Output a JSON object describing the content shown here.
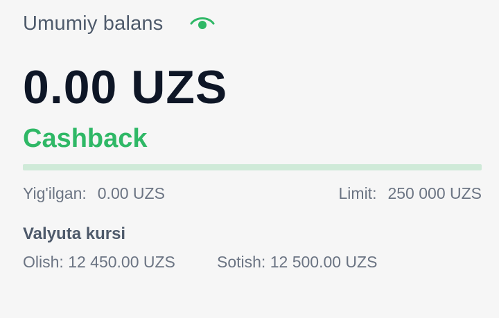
{
  "balance": {
    "label": "Umumiy balans",
    "value": "0.00 UZS",
    "visibility_icon": "eye-icon"
  },
  "cashback": {
    "title": "Cashback",
    "progress_percent": 0,
    "collected_label": "Yig'ilgan:",
    "collected_value": "0.00 UZS",
    "limit_label": "Limit:",
    "limit_value": "250 000 UZS"
  },
  "rates": {
    "title": "Valyuta kursi",
    "buy_label": "Olish:",
    "buy_value": "12 450.00 UZS",
    "sell_label": "Sotish:",
    "sell_value": "12 500.00 UZS"
  },
  "colors": {
    "accent": "#2fb866",
    "progress_track": "#cfead8",
    "background": "#f6f6f6",
    "primary_text": "#0e1626",
    "secondary_text": "#6b7483"
  }
}
